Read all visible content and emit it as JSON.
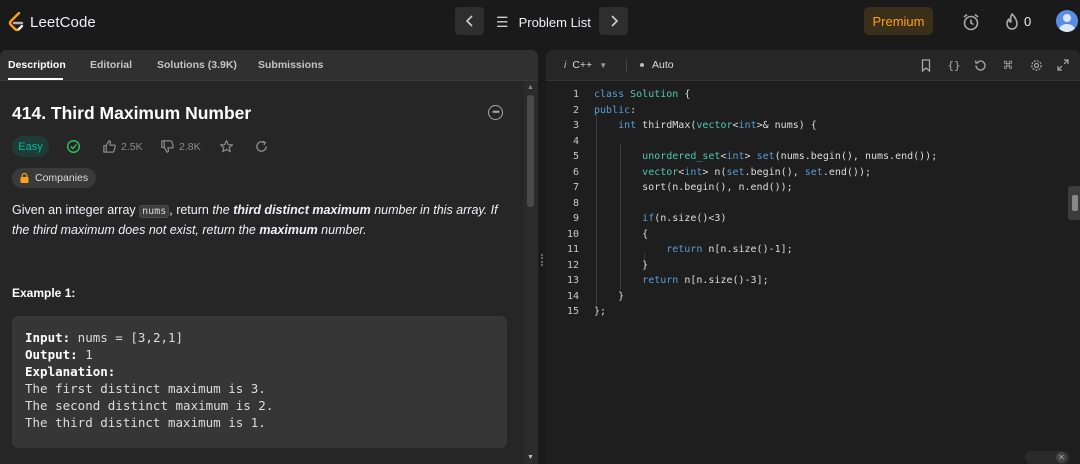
{
  "topbar": {
    "logo_text": "LeetCode",
    "problem_list": "Problem List",
    "premium": "Premium",
    "streak_count": "0"
  },
  "tabs": [
    "Description",
    "Editorial",
    "Solutions (3.9K)",
    "Submissions"
  ],
  "problem": {
    "title": "414. Third Maximum Number",
    "difficulty": "Easy",
    "likes": "2.5K",
    "dislikes": "2.8K",
    "companies": "Companies",
    "desc_1": "Given an integer array ",
    "desc_code": "nums",
    "desc_2": ", return ",
    "desc_3": "the ",
    "desc_4": "third distinct maximum",
    "desc_5": " number in this array. If the third maximum does not exist, return the ",
    "desc_6": "maximum",
    "desc_7": " number.",
    "example_heading": "Example 1:",
    "example": {
      "input_label": "Input:",
      "input_value": " nums = [3,2,1]",
      "output_label": "Output:",
      "output_value": " 1",
      "explanation_label": "Explanation:",
      "lines": [
        "The first distinct maximum is 3.",
        "The second distinct maximum is 2.",
        "The third distinct maximum is 1."
      ]
    }
  },
  "editor": {
    "language": "C++",
    "lang_icon": "i",
    "mode": "Auto",
    "code": [
      "class Solution {",
      "public:",
      "    int thirdMax(vector<int>& nums) {",
      "",
      "        unordered_set<int> set(nums.begin(), nums.end());",
      "        vector<int> n(set.begin(), set.end());",
      "        sort(n.begin(), n.end());",
      "",
      "        if(n.size()<3)",
      "        {",
      "            return n[n.size()-1];",
      "        }",
      "        return n[n.size()-3];",
      "    }",
      "};"
    ]
  },
  "colors": {
    "accent": "#ffa116",
    "easy": "#00b8a3",
    "check": "#2cbb5d",
    "keyword": "#569cd6",
    "type": "#4ec9b0"
  }
}
